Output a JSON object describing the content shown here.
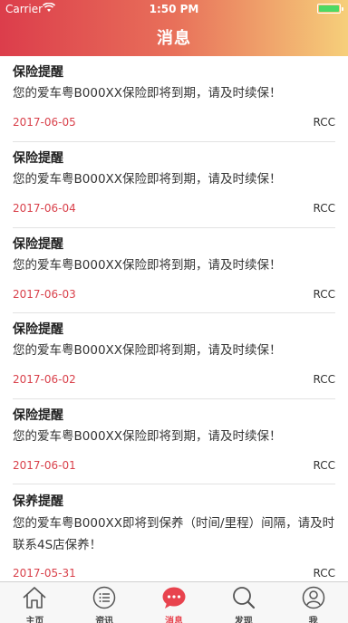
{
  "status_bar": {
    "carrier": "Carrier",
    "time": "1:50 PM"
  },
  "header": {
    "title": "消息"
  },
  "messages": [
    {
      "title": "保险提醒",
      "body": "您的爱车粤B000XX保险即将到期，请及时续保！",
      "date": "2017-06-05",
      "source": "RCC"
    },
    {
      "title": "保险提醒",
      "body": "您的爱车粤B000XX保险即将到期，请及时续保！",
      "date": "2017-06-04",
      "source": "RCC"
    },
    {
      "title": "保险提醒",
      "body": "您的爱车粤B000XX保险即将到期，请及时续保！",
      "date": "2017-06-03",
      "source": "RCC"
    },
    {
      "title": "保险提醒",
      "body": "您的爱车粤B000XX保险即将到期，请及时续保！",
      "date": "2017-06-02",
      "source": "RCC"
    },
    {
      "title": "保险提醒",
      "body": "您的爱车粤B000XX保险即将到期，请及时续保！",
      "date": "2017-06-01",
      "source": "RCC"
    },
    {
      "title": "保养提醒",
      "body": "您的爱车粤B000XX即将到保养（时间/里程）间隔，请及时联系4S店保养！",
      "date": "2017-05-31",
      "source": "RCC"
    }
  ],
  "tabbar": {
    "tabs": [
      {
        "label": "主页",
        "icon": "home-icon"
      },
      {
        "label": "资讯",
        "icon": "list-icon"
      },
      {
        "label": "消息",
        "icon": "chat-bubble-icon",
        "active": true
      },
      {
        "label": "发现",
        "icon": "search-icon"
      },
      {
        "label": "我",
        "icon": "user-icon"
      }
    ]
  },
  "colors": {
    "accent": "#e8434e",
    "date": "#d9414b",
    "header_start": "#dc3d4b",
    "header_end": "#f6cf7a"
  }
}
